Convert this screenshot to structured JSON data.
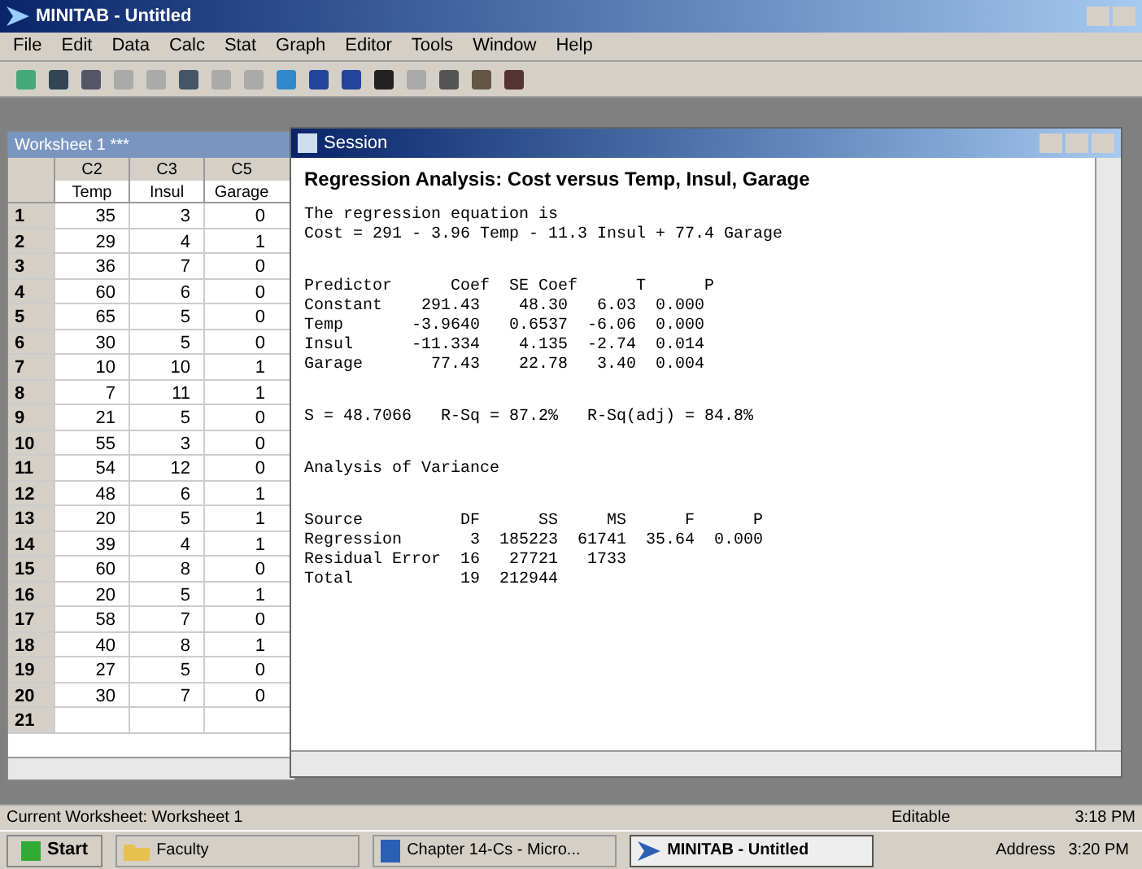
{
  "app_title": "MINITAB - Untitled",
  "menu": [
    "File",
    "Edit",
    "Data",
    "Calc",
    "Stat",
    "Graph",
    "Editor",
    "Tools",
    "Window",
    "Help"
  ],
  "worksheet": {
    "title": "Worksheet 1 ***",
    "columns": [
      {
        "id": "C2",
        "name": "Temp"
      },
      {
        "id": "C3",
        "name": "Insul"
      },
      {
        "id": "C5",
        "name": "Garage"
      }
    ],
    "rows": [
      {
        "n": "1",
        "cells": [
          "35",
          "3",
          "0"
        ]
      },
      {
        "n": "2",
        "cells": [
          "29",
          "4",
          "1"
        ]
      },
      {
        "n": "3",
        "cells": [
          "36",
          "7",
          "0"
        ]
      },
      {
        "n": "4",
        "cells": [
          "60",
          "6",
          "0"
        ]
      },
      {
        "n": "5",
        "cells": [
          "65",
          "5",
          "0"
        ]
      },
      {
        "n": "6",
        "cells": [
          "30",
          "5",
          "0"
        ]
      },
      {
        "n": "7",
        "cells": [
          "10",
          "10",
          "1"
        ]
      },
      {
        "n": "8",
        "cells": [
          "7",
          "11",
          "1"
        ]
      },
      {
        "n": "9",
        "cells": [
          "21",
          "5",
          "0"
        ]
      },
      {
        "n": "10",
        "cells": [
          "55",
          "3",
          "0"
        ]
      },
      {
        "n": "11",
        "cells": [
          "54",
          "12",
          "0"
        ]
      },
      {
        "n": "12",
        "cells": [
          "48",
          "6",
          "1"
        ]
      },
      {
        "n": "13",
        "cells": [
          "20",
          "5",
          "1"
        ]
      },
      {
        "n": "14",
        "cells": [
          "39",
          "4",
          "1"
        ]
      },
      {
        "n": "15",
        "cells": [
          "60",
          "8",
          "0"
        ]
      },
      {
        "n": "16",
        "cells": [
          "20",
          "5",
          "1"
        ]
      },
      {
        "n": "17",
        "cells": [
          "58",
          "7",
          "0"
        ]
      },
      {
        "n": "18",
        "cells": [
          "40",
          "8",
          "1"
        ]
      },
      {
        "n": "19",
        "cells": [
          "27",
          "5",
          "0"
        ]
      },
      {
        "n": "20",
        "cells": [
          "30",
          "7",
          "0"
        ]
      },
      {
        "n": "21",
        "cells": []
      }
    ]
  },
  "session": {
    "title": "Session",
    "heading": "Regression Analysis: Cost versus Temp, Insul, Garage",
    "blocks": [
      [
        "The regression equation is",
        "Cost = 291 - 3.96 Temp - 11.3 Insul + 77.4 Garage"
      ],
      [
        "Predictor      Coef  SE Coef      T      P",
        "Constant    291.43    48.30   6.03  0.000",
        "Temp       -3.9640   0.6537  -6.06  0.000",
        "Insul      -11.334    4.135  -2.74  0.014",
        "Garage       77.43    22.78   3.40  0.004"
      ],
      [
        "S = 48.7066   R-Sq = 87.2%   R-Sq(adj) = 84.8%"
      ],
      [
        "Analysis of Variance"
      ],
      [
        "Source          DF      SS     MS      F      P",
        "Regression       3  185223  61741  35.64  0.000",
        "Residual Error  16   27721   1733",
        "Total           19  212944"
      ]
    ]
  },
  "status_bar": {
    "text": "Current Worksheet: Worksheet 1",
    "mode": "Editable",
    "time": "3:18 PM"
  },
  "taskbar": {
    "start": "Start",
    "items": [
      {
        "label": "Faculty",
        "selected": false,
        "kind": "folder"
      },
      {
        "label": "Chapter 14-Cs - Micro...",
        "selected": false,
        "kind": "doc"
      },
      {
        "label": "MINITAB - Untitled",
        "selected": true,
        "kind": "app"
      }
    ],
    "address": "Address",
    "clock": "3:20 PM"
  }
}
